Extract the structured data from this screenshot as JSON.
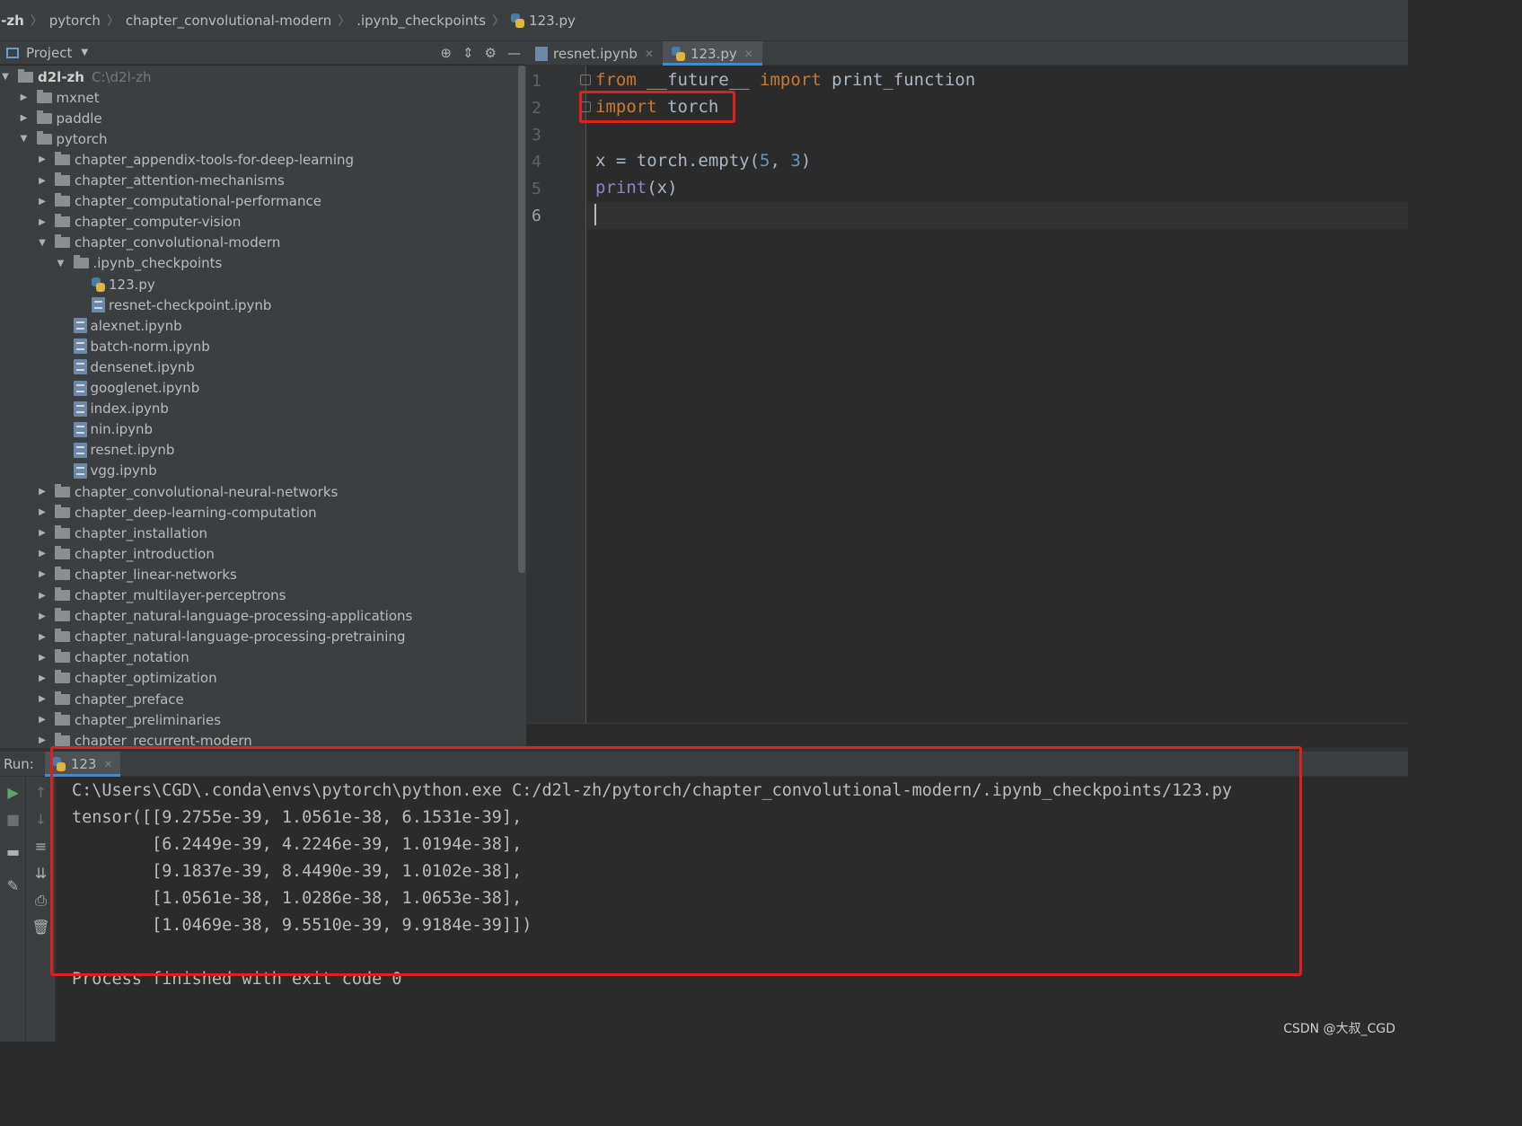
{
  "breadcrumb": [
    "l-zh",
    "pytorch",
    "chapter_convolutional-modern",
    ".ipynb_checkpoints",
    "123.py"
  ],
  "project_panel": {
    "title": "Project",
    "tree": [
      {
        "label": "d2l-zh",
        "path": "C:\\d2l-zh",
        "type": "folder",
        "expanded": true
      },
      {
        "label": "mxnet",
        "type": "folder",
        "expanded": false
      },
      {
        "label": "paddle",
        "type": "folder",
        "expanded": false
      },
      {
        "label": "pytorch",
        "type": "folder",
        "expanded": true
      },
      {
        "label": "chapter_appendix-tools-for-deep-learning",
        "type": "folder",
        "expanded": false
      },
      {
        "label": "chapter_attention-mechanisms",
        "type": "folder",
        "expanded": false
      },
      {
        "label": "chapter_computational-performance",
        "type": "folder",
        "expanded": false
      },
      {
        "label": "chapter_computer-vision",
        "type": "folder",
        "expanded": false
      },
      {
        "label": "chapter_convolutional-modern",
        "type": "folder",
        "expanded": true
      },
      {
        "label": ".ipynb_checkpoints",
        "type": "folder",
        "expanded": true
      },
      {
        "label": "123.py",
        "type": "py"
      },
      {
        "label": "resnet-checkpoint.ipynb",
        "type": "ipynb"
      },
      {
        "label": "alexnet.ipynb",
        "type": "ipynb"
      },
      {
        "label": "batch-norm.ipynb",
        "type": "ipynb"
      },
      {
        "label": "densenet.ipynb",
        "type": "ipynb"
      },
      {
        "label": "googlenet.ipynb",
        "type": "ipynb"
      },
      {
        "label": "index.ipynb",
        "type": "ipynb"
      },
      {
        "label": "nin.ipynb",
        "type": "ipynb"
      },
      {
        "label": "resnet.ipynb",
        "type": "ipynb"
      },
      {
        "label": "vgg.ipynb",
        "type": "ipynb"
      },
      {
        "label": "chapter_convolutional-neural-networks",
        "type": "folder",
        "expanded": false
      },
      {
        "label": "chapter_deep-learning-computation",
        "type": "folder",
        "expanded": false
      },
      {
        "label": "chapter_installation",
        "type": "folder",
        "expanded": false
      },
      {
        "label": "chapter_introduction",
        "type": "folder",
        "expanded": false
      },
      {
        "label": "chapter_linear-networks",
        "type": "folder",
        "expanded": false
      },
      {
        "label": "chapter_multilayer-perceptrons",
        "type": "folder",
        "expanded": false
      },
      {
        "label": "chapter_natural-language-processing-applications",
        "type": "folder",
        "expanded": false
      },
      {
        "label": "chapter_natural-language-processing-pretraining",
        "type": "folder",
        "expanded": false
      },
      {
        "label": "chapter_notation",
        "type": "folder",
        "expanded": false
      },
      {
        "label": "chapter_optimization",
        "type": "folder",
        "expanded": false
      },
      {
        "label": "chapter_preface",
        "type": "folder",
        "expanded": false
      },
      {
        "label": "chapter_preliminaries",
        "type": "folder",
        "expanded": false
      },
      {
        "label": "chapter_recurrent-modern",
        "type": "folder",
        "expanded": false
      }
    ]
  },
  "editor": {
    "tabs": [
      {
        "label": "resnet.ipynb",
        "active": false
      },
      {
        "label": "123.py",
        "active": true
      }
    ],
    "line_numbers": [
      "1",
      "2",
      "3",
      "4",
      "5",
      "6"
    ],
    "code": {
      "l1_from": "from",
      "l1_mod": " __future__ ",
      "l1_import": "import",
      "l1_rest": " print_function",
      "l2_import": "import",
      "l2_rest": " torch",
      "l4_a": "x = torch.empty(",
      "l4_n1": "5",
      "l4_b": ", ",
      "l4_n2": "3",
      "l4_c": ")",
      "l5_print": "print",
      "l5_rest": "(x)"
    }
  },
  "run_panel": {
    "label": "Run:",
    "tab_label": "123",
    "console": [
      "C:\\Users\\CGD\\.conda\\envs\\pytorch\\python.exe C:/d2l-zh/pytorch/chapter_convolutional-modern/.ipynb_checkpoints/123.py",
      "tensor([[9.2755e-39, 1.0561e-38, 6.1531e-39],",
      "        [6.2449e-39, 4.2246e-39, 1.0194e-38],",
      "        [9.1837e-39, 8.4490e-39, 1.0102e-38],",
      "        [1.0561e-38, 1.0286e-38, 1.0653e-38],",
      "        [1.0469e-38, 9.5510e-39, 9.9184e-39]])",
      "",
      "Process finished with exit code 0"
    ]
  },
  "watermark": "CSDN @大叔_CGD",
  "colors": {
    "highlight_border": "#e02020",
    "keyword": "#cc7832",
    "number": "#6897bb",
    "builtin": "#8888c6"
  }
}
